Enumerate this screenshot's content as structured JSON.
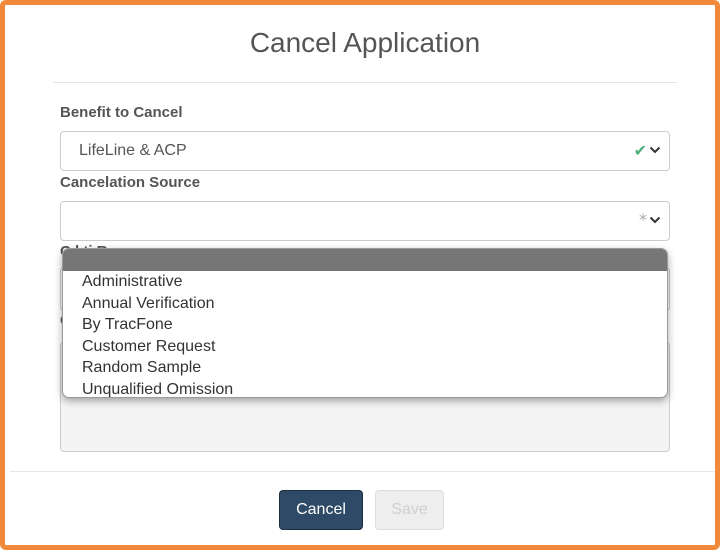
{
  "dialog": {
    "title": "Cancel Application"
  },
  "benefit": {
    "label": "Benefit to Cancel",
    "value": "LifeLine & ACP",
    "status_icon": "check-icon",
    "status_color": "#4caf7d"
  },
  "source": {
    "label": "Cancelation Source",
    "value": "",
    "status_icon": "asterisk-icon",
    "status_color": "#aaaaaa"
  },
  "reason": {
    "label_fragment": "C    l ti   R"
  },
  "comments": {
    "label_fragment": "C"
  },
  "dropdown": {
    "options": [
      "Administrative",
      "Annual Verification",
      "By TracFone",
      "Customer Request",
      "Random Sample",
      "Unqualified Omission"
    ]
  },
  "footer": {
    "cancel_label": "Cancel",
    "save_label": "Save"
  },
  "colors": {
    "accent_border": "#f0893a",
    "primary_button": "#2e4a66"
  }
}
